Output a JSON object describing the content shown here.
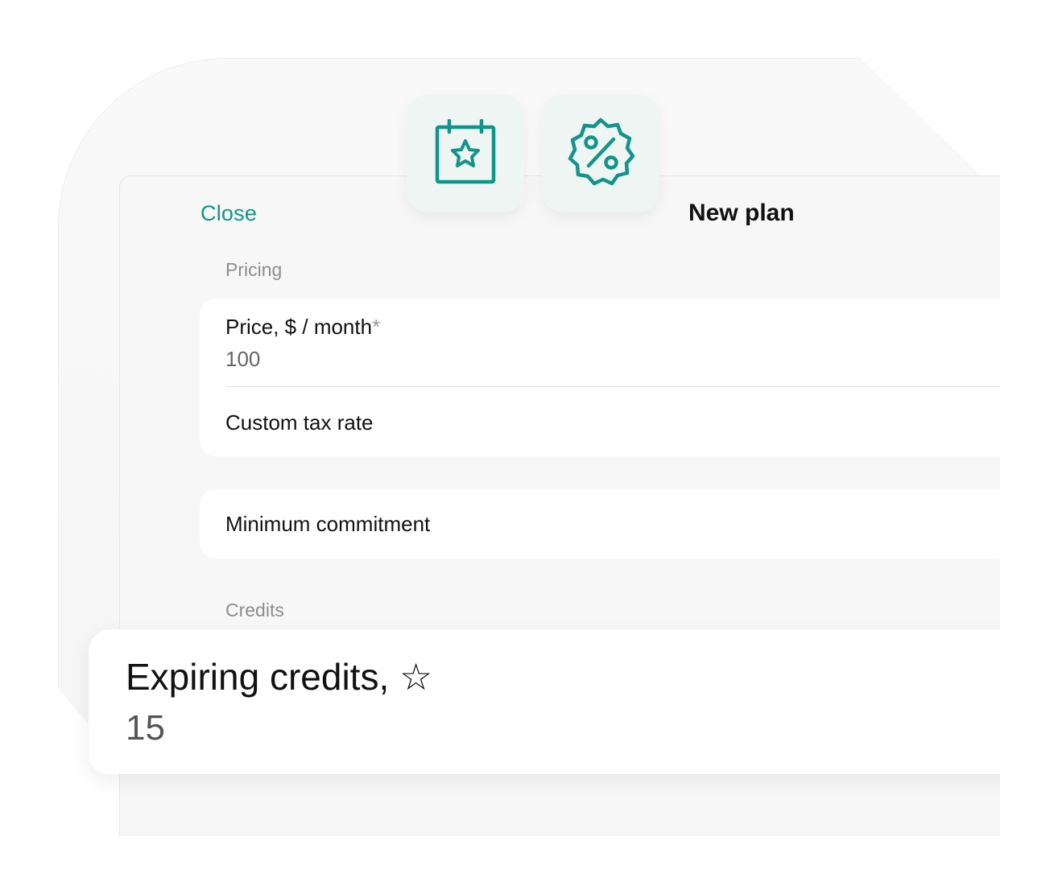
{
  "header": {
    "close_label": "Close",
    "title": "New plan"
  },
  "icons": {
    "calendar": "calendar-star-icon",
    "discount": "percent-badge-icon",
    "accent": "#12948a"
  },
  "pricing": {
    "section_label": "Pricing",
    "price_label": "Price, $ / month",
    "price_required": "*",
    "price_value": "100",
    "tax_label": "Custom tax rate"
  },
  "commitment": {
    "label": "Minimum commitment"
  },
  "credits": {
    "section_label": "Credits",
    "expiring_label": "Expiring credits, ☆",
    "expiring_value": "15"
  }
}
